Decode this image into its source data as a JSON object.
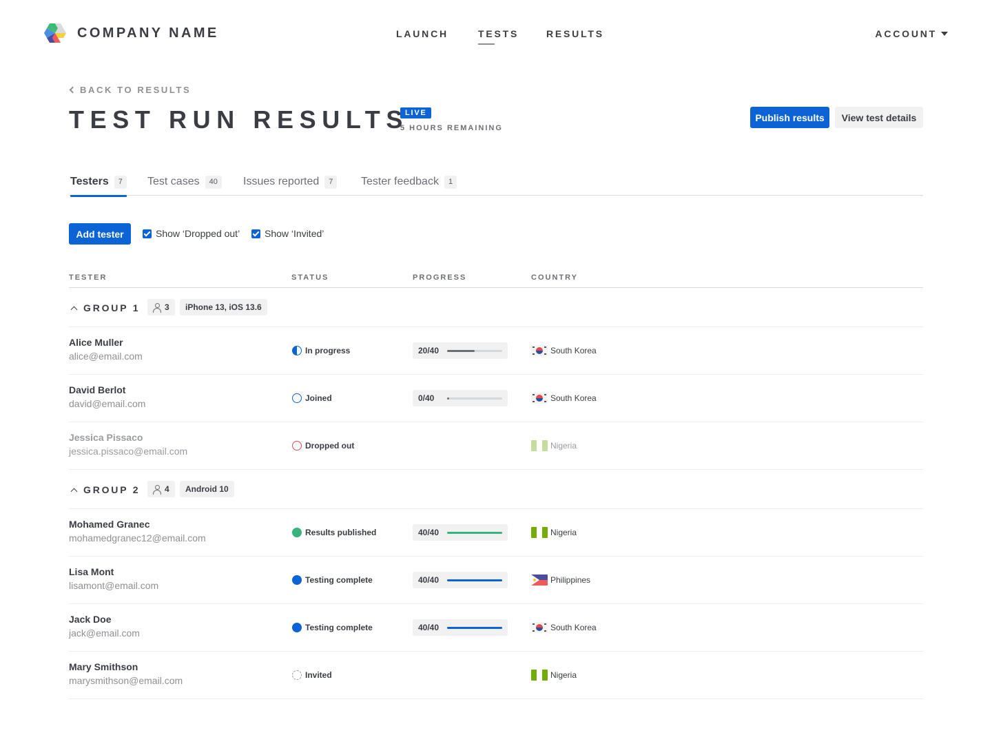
{
  "nav": {
    "brand": "COMPANY NAME",
    "links": [
      {
        "label": "LAUNCH",
        "active": false
      },
      {
        "label": "TESTS",
        "active": true
      },
      {
        "label": "RESULTS",
        "active": false
      }
    ],
    "account_label": "ACCOUNT"
  },
  "header": {
    "back_label": "BACK TO RESULTS",
    "title": "TEST RUN RESULTS",
    "live_badge": "LIVE",
    "remaining": "5 HOURS REMAINING",
    "publish_button": "Publish results",
    "details_button": "View test details"
  },
  "tabs": [
    {
      "label": "Testers",
      "count": "7",
      "active": true
    },
    {
      "label": "Test cases",
      "count": "40",
      "active": false
    },
    {
      "label": "Issues reported",
      "count": "7",
      "active": false
    },
    {
      "label": "Tester feedback",
      "count": "1",
      "active": false
    }
  ],
  "toolbar": {
    "add_button": "Add tester",
    "show_dropped_label": "Show ‘Dropped out’",
    "show_dropped_checked": true,
    "show_invited_label": "Show ‘Invited’",
    "show_invited_checked": true
  },
  "table": {
    "columns": [
      "TESTER",
      "STATUS",
      "PROGRESS",
      "COUNTRY"
    ],
    "groups": [
      {
        "label": "GROUP 1",
        "member_count": "3",
        "device": "iPhone 13, iOS 13.6",
        "expanded": true,
        "rows": [
          {
            "name": "Alice Muller",
            "email": "alice@email.com",
            "status": "In progress",
            "status_type": "inprogress",
            "progress_text": "20/40",
            "progress": 0.5,
            "progress_color": "#6b6e74",
            "country": "South Korea",
            "flag": "kr",
            "dimmed": false
          },
          {
            "name": "David Berlot",
            "email": "david@email.com",
            "status": "Joined",
            "status_type": "joined",
            "progress_text": "0/40",
            "progress": 0,
            "progress_color": "#6b6e74",
            "country": "South Korea",
            "flag": "kr",
            "dimmed": false
          },
          {
            "name": "Jessica Pissaco",
            "email": "jessica.pissaco@email.com",
            "status": "Dropped out",
            "status_type": "dropped",
            "progress_text": null,
            "progress": null,
            "progress_color": null,
            "country": "Nigeria",
            "flag": "ng",
            "dimmed": true
          }
        ]
      },
      {
        "label": "GROUP 2",
        "member_count": "4",
        "device": "Android 10",
        "expanded": true,
        "rows": [
          {
            "name": "Mohamed Granec",
            "email": "mohamedgranec12@email.com",
            "status": "Results published",
            "status_type": "published",
            "progress_text": "40/40",
            "progress": 1,
            "progress_color": "#37b37e",
            "country": "Nigeria",
            "flag": "ng",
            "dimmed": false
          },
          {
            "name": "Lisa Mont",
            "email": "lisamont@email.com",
            "status": "Testing complete",
            "status_type": "complete",
            "progress_text": "40/40",
            "progress": 1,
            "progress_color": "#0b63d6",
            "country": "Philippines",
            "flag": "ph",
            "dimmed": false
          },
          {
            "name": "Jack Doe",
            "email": "jack@email.com",
            "status": "Testing complete",
            "status_type": "complete",
            "progress_text": "40/40",
            "progress": 1,
            "progress_color": "#0b63d6",
            "country": "South Korea",
            "flag": "kr",
            "dimmed": false
          },
          {
            "name": "Mary Smithson",
            "email": "marysmithson@email.com",
            "status": "Invited",
            "status_type": "invited",
            "progress_text": null,
            "progress": null,
            "progress_color": null,
            "country": "Nigeria",
            "flag": "ng",
            "dimmed": false
          }
        ]
      }
    ]
  },
  "colors": {
    "accent": "#0b63d6",
    "success": "#37b37e",
    "danger": "#e04a4a",
    "text": "#3a3d44",
    "muted": "#8e9096"
  }
}
